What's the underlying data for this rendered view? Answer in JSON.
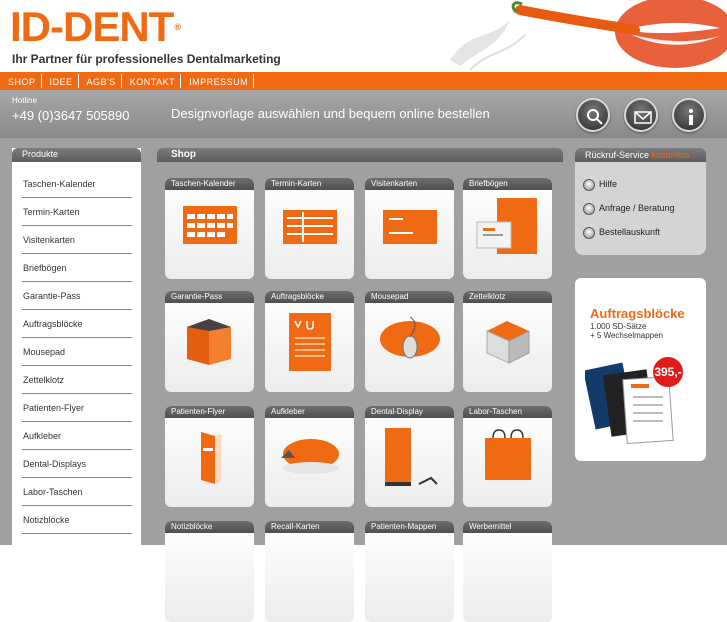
{
  "header": {
    "logo": "ID-DENT",
    "logo_mark": "®",
    "tagline": "Ihr Partner für professionelles Dentalmarketing"
  },
  "nav": {
    "items": [
      "SHOP",
      "IDEE",
      "AGB'S",
      "KONTAKT",
      "IMPRESSUM"
    ]
  },
  "topbar": {
    "hotline_label": "Hotline",
    "hotline_number": "+49 (0)3647 505890",
    "slogan": "Designvorlage auswählen und bequem online bestellen",
    "icons": [
      "search-icon",
      "mail-icon",
      "info-icon"
    ]
  },
  "sidebar": {
    "title": "Produkte",
    "items": [
      "Taschen-Kalender",
      "Termin-Karten",
      "Visitenkarten",
      "Briefbögen",
      "Garantie-Pass",
      "Auftragsblöcke",
      "Mousepad",
      "Zettelklotz",
      "Patienten-Flyer",
      "Aufkleber",
      "Dental-Displays",
      "Labor-Taschen",
      "Notizblöcke"
    ]
  },
  "shop": {
    "title": "Shop",
    "tiles": [
      "Taschen-Kalender",
      "Termin-Karten",
      "Visitenkarten",
      "Briefbögen",
      "Garantie-Pass",
      "Auftragsblöcke",
      "Mousepad",
      "Zettelklotz",
      "Patienten-Flyer",
      "Aufkleber",
      "Dental-Display",
      "Labor-Taschen",
      "Notizblöcke",
      "Recall-Karten",
      "Patienten-Mappen",
      "Werbemittel"
    ]
  },
  "callback": {
    "title": "Rückruf-Service",
    "title_accent": "kostenlos",
    "options": [
      "Hilfe",
      "Anfrage / Beratung",
      "Bestellauskunft"
    ]
  },
  "promo": {
    "title": "Auftragsblöcke",
    "line1": "1.000 SD-Sätze",
    "line2": "+ 5 Wechselmappen",
    "price": "395,-"
  },
  "colors": {
    "accent": "#f06a14",
    "panel": "#a0a0a0"
  }
}
